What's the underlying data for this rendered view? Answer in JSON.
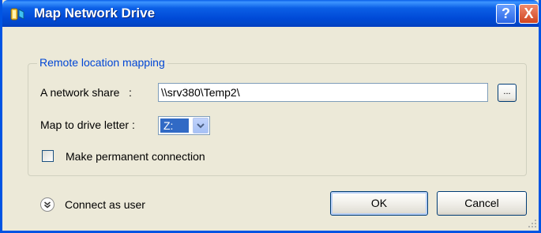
{
  "window": {
    "title": "Map Network Drive",
    "help_button": "?",
    "close_button": "X",
    "icon": "map-network-drive-icon"
  },
  "group": {
    "legend": "Remote location mapping",
    "share_label": "A network share   :",
    "share_value": "\\\\srv380\\Temp2\\",
    "browse_label": "...",
    "drive_label": "Map to drive letter :",
    "drive_value": "Z:",
    "permanent_label": "Make permanent connection",
    "permanent_checked": false
  },
  "footer": {
    "connect_as_user": "Connect as user",
    "ok_label": "OK",
    "cancel_label": "Cancel"
  },
  "colors": {
    "titlebar": "#0054e3",
    "legend_text": "#0046d5",
    "selection": "#316ac5",
    "dialog_bg": "#ece9d8"
  }
}
